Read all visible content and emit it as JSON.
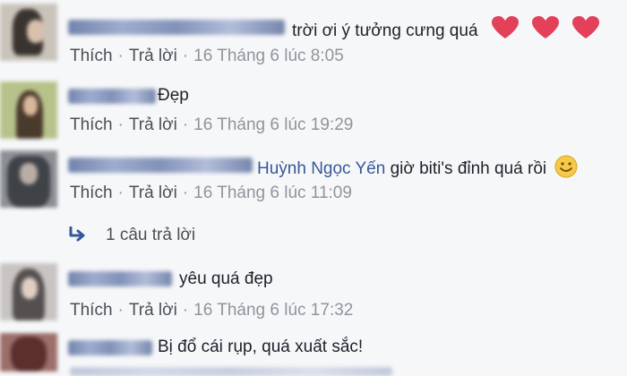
{
  "comments": [
    {
      "text": "trời ơi ý tưởng cưng quá",
      "like_label": "Thích",
      "reply_label": "Trả lời",
      "timestamp": "16 Tháng 6 lúc 8:05",
      "hearts": 3
    },
    {
      "text": "Đẹp",
      "like_label": "Thích",
      "reply_label": "Trả lời",
      "timestamp": "16 Tháng 6 lúc 19:29"
    },
    {
      "tagged_name": "Huỳnh Ngọc Yến",
      "text": "giờ biti's đỉnh quá rồi",
      "like_label": "Thích",
      "reply_label": "Trả lời",
      "timestamp": "16 Tháng 6 lúc 11:09",
      "replies_label": "1 câu trả lời"
    },
    {
      "text": "yêu quá đẹp",
      "like_label": "Thích",
      "reply_label": "Trả lời",
      "timestamp": "16 Tháng 6 lúc 17:32"
    },
    {
      "text": "Bị đổ cái rụp, quá xuất sắc!"
    }
  ],
  "colors": {
    "background": "#f6f7f9",
    "link": "#365899",
    "text": "#1d2129",
    "meta": "#90949c",
    "heart": "#e3405a"
  },
  "icons": [
    "heart-icon",
    "smile-emoji-icon",
    "reply-arrow-icon"
  ]
}
